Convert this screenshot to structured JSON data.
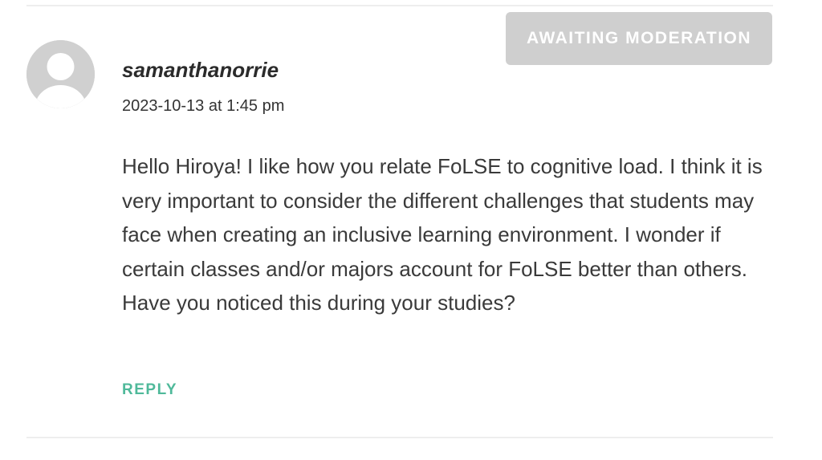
{
  "comment": {
    "author": "samanthanorrie",
    "timestamp": "2023-10-13 at 1:45 pm",
    "status_badge": "AWAITING MODERATION",
    "body": "Hello Hiroya! I like how you relate FoLSE to cognitive load. I think it is very important to consider the different challenges that students may face when creating an inclusive learning environment. I wonder if certain classes and/or majors account for FoLSE better than others. Have you noticed this during your studies?",
    "reply_label": "REPLY",
    "avatar_icon": "default-user-avatar-icon"
  },
  "colors": {
    "badge_background": "#cfcfcf",
    "badge_text": "#ffffff",
    "reply_accent": "#4fb99a",
    "avatar_background": "#d0d0d0",
    "divider": "#eeeeee"
  }
}
